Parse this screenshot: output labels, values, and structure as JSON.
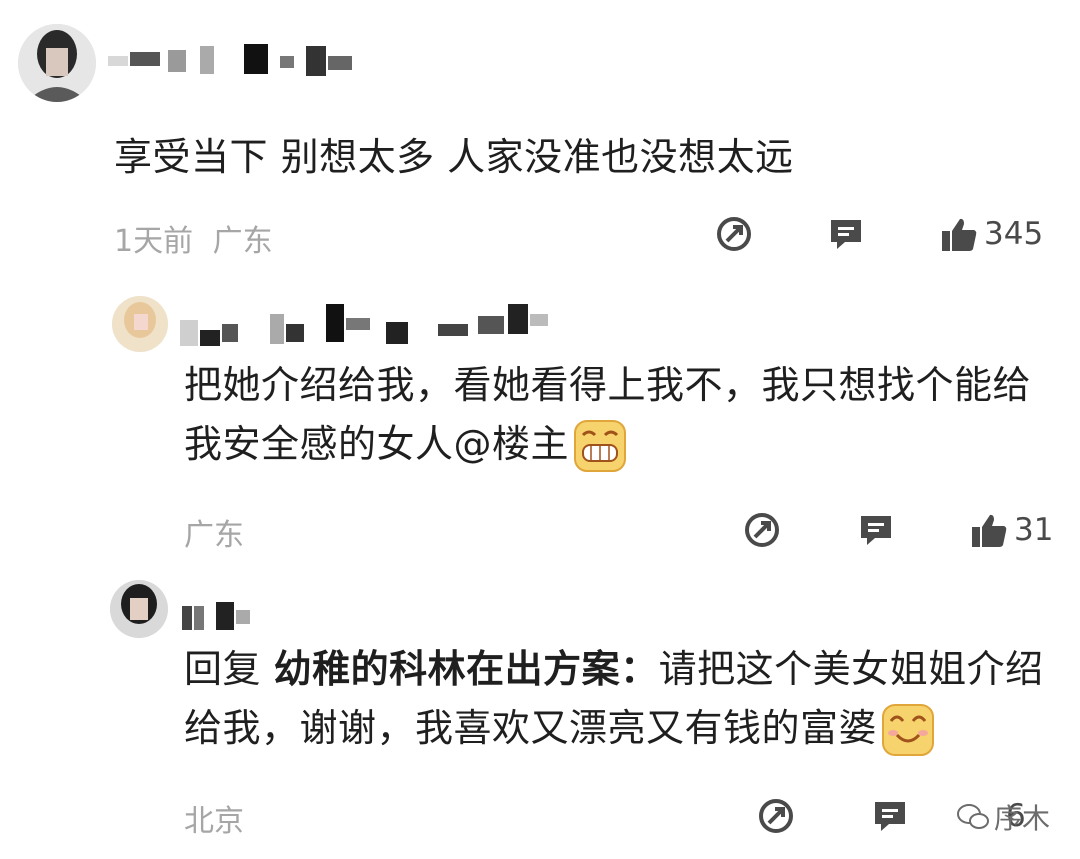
{
  "comments": [
    {
      "text": "享受当下 别想太多 人家没准也没想太远",
      "time": "1天前",
      "location": "广东",
      "like_count": "345"
    },
    {
      "text": "把她介绍给我，看她看得上我不，我只想找个能给我安全感的女人@楼主",
      "location": "广东",
      "like_count": "31"
    },
    {
      "reply_prefix": "回复",
      "reply_target": "幼稚的科林在出方案：",
      "text": "请把这个美女姐姐介绍给我，谢谢，我喜欢又漂亮又有钱的富婆",
      "location": "北京",
      "like_count": "6"
    }
  ],
  "watermark": "序木",
  "icons": [
    "share-icon",
    "reply-icon",
    "thumbs-up-icon",
    "grin-emoji",
    "smile-emoji"
  ],
  "colors": {
    "meta": "#a6a6a6",
    "text": "#1f1f1f",
    "icon": "#4a4a4a"
  }
}
